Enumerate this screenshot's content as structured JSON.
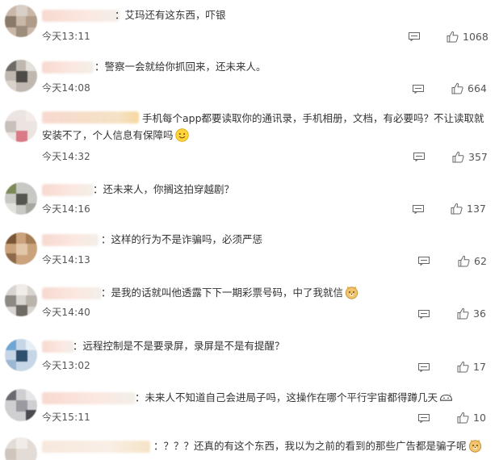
{
  "comments": [
    {
      "text": "：艾玛还有这东西，吓银",
      "time": "今天13:11",
      "likes": "1068"
    },
    {
      "text": "：警察一会就给你抓回来，还未来人。",
      "time": "今天14:08",
      "likes": "664"
    },
    {
      "text": "手机每个app都要读取你的通讯录，手机相册，文档，有必要吗？不让读取就安装不了，个人信息有保障吗",
      "time": "今天14:32",
      "likes": "357"
    },
    {
      "text": "：还未来人，你搁这拍穿越剧？",
      "time": "今天14:16",
      "likes": "137"
    },
    {
      "text": "：这样的行为不是诈骗吗，必须严惩",
      "time": "今天14:13",
      "likes": "62"
    },
    {
      "text": "：是我的话就叫他透露下下一期彩票号码，中了我就信",
      "time": "今天14:40",
      "likes": "36"
    },
    {
      "text": "：远程控制是不是要录屏，录屏是不是有提醒？",
      "time": "今天13:02",
      "likes": "17"
    },
    {
      "text": "：未来人不知道自己会进局子吗，这操作在哪个平行宇宙都得蹲几天",
      "time": "今天15:11",
      "likes": "10"
    },
    {
      "text": "：？？？还真的有这个东西，我以为之前的看到的那些广告都是骗子呢",
      "time": "",
      "likes": ""
    }
  ],
  "icons": {
    "reply": "comment-icon",
    "like": "thumbs-up-icon",
    "emoji_smile": "smile-emoji",
    "emoji_doge": "doge-emoji",
    "emoji_sweat": "sweat-emoji"
  },
  "colors": {
    "text": "#333333",
    "meta": "#555555",
    "icon": "#666666"
  }
}
